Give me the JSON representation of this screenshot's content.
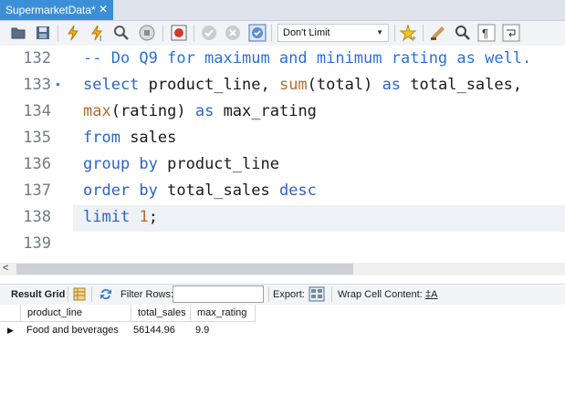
{
  "tab": {
    "title": "SupermarketData*",
    "close": "✕"
  },
  "toolbar": {
    "limit_value": "Don't Limit",
    "icons": [
      "open-folder-icon",
      "save-icon",
      "execute-icon",
      "execute-current-icon",
      "explain-icon",
      "stop-icon",
      "toggle-error-icon",
      "commit-icon",
      "rollback-icon",
      "autocommit-icon",
      "bookmark-star-icon",
      "beautify-icon",
      "find-icon",
      "invisible-chars-icon",
      "wrap-icon"
    ]
  },
  "editor": {
    "lines": [
      {
        "number": "132",
        "marker": ""
      },
      {
        "number": "133",
        "marker": "•"
      },
      {
        "number": "134",
        "marker": ""
      },
      {
        "number": "135",
        "marker": ""
      },
      {
        "number": "136",
        "marker": ""
      },
      {
        "number": "137",
        "marker": ""
      },
      {
        "number": "138",
        "marker": ""
      },
      {
        "number": "139",
        "marker": ""
      }
    ],
    "code": {
      "l132": "-- Do Q9 for maximum and minimum rating as well.",
      "l133_kw1": "select",
      "l133_t1": " product_line, ",
      "l133_fn": "sum",
      "l133_t2": "(total) ",
      "l133_kw2": "as",
      "l133_t3": " total_sales,",
      "l134_fn": "max",
      "l134_t1": "(rating) ",
      "l134_kw": "as",
      "l134_t2": " max_rating",
      "l135_kw": "from",
      "l135_t": " sales",
      "l136_kw": "group by",
      "l136_t": " product_line",
      "l137_kw1": "order by",
      "l137_t": " total_sales ",
      "l137_kw2": "desc",
      "l138_kw": "limit",
      "l138_num": "1",
      "l138_t": ";"
    }
  },
  "scroll": {
    "left_arrow": "<"
  },
  "result_toolbar": {
    "result_grid": "Result Grid",
    "filter_rows": "Filter Rows:",
    "filter_value": "",
    "export": "Export:",
    "wrap": "Wrap Cell Content:",
    "wrap_icon_text": "‡A"
  },
  "grid": {
    "columns": [
      "product_line",
      "total_sales",
      "max_rating"
    ],
    "rows": [
      {
        "product_line": "Food and beverages",
        "total_sales": "56144.96",
        "max_rating": "9.9"
      }
    ]
  }
}
